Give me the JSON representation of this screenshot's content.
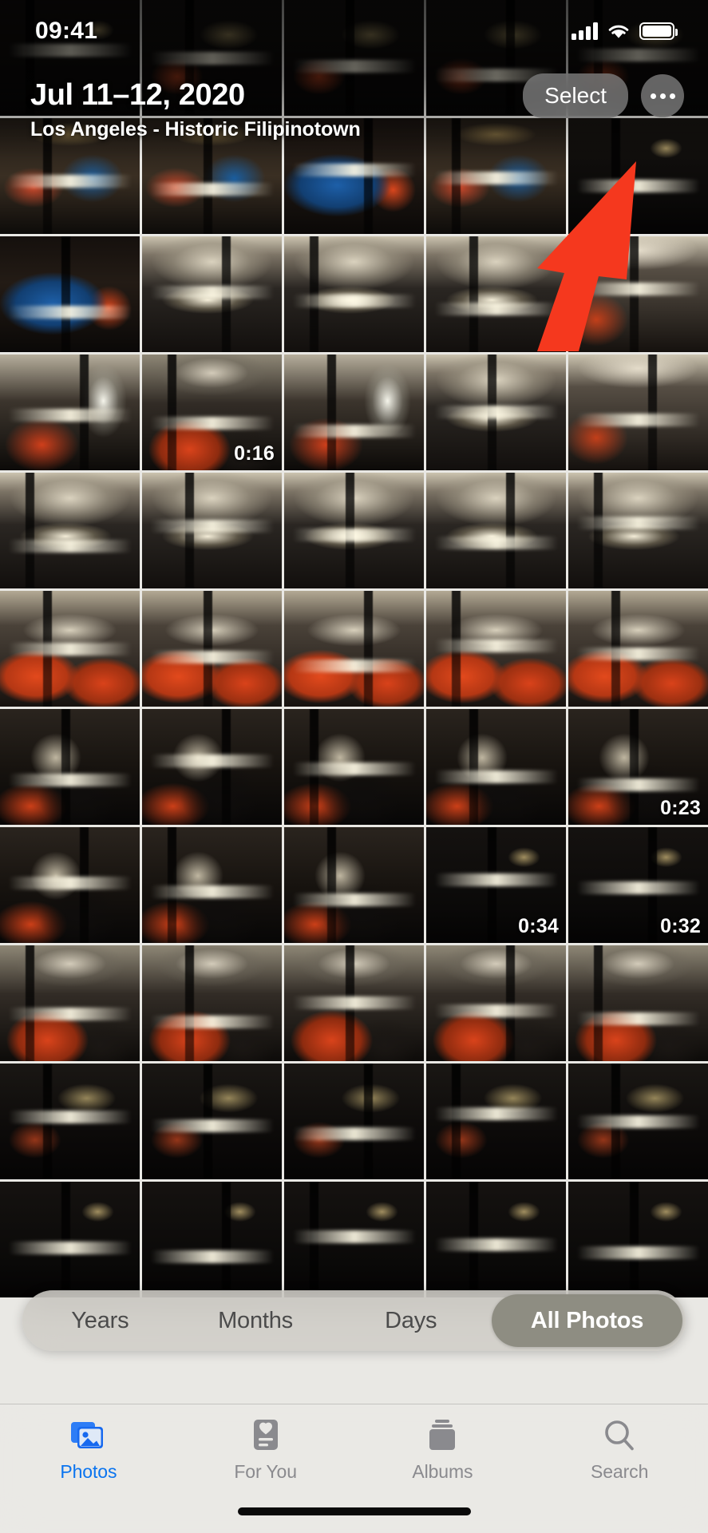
{
  "status_bar": {
    "time": "09:41",
    "cellular_icon": "signal-bars-icon",
    "wifi_icon": "wifi-icon",
    "battery_icon": "battery-full-icon"
  },
  "nav": {
    "title": "Jul 11–12, 2020",
    "subtitle": "Los Angeles - Historic Filipinotown",
    "select_label": "Select",
    "more_icon": "ellipsis-icon"
  },
  "annotation": {
    "type": "arrow",
    "color": "#F5381E",
    "points_to": "more-button"
  },
  "segmented_control": {
    "options": [
      "Years",
      "Months",
      "Days",
      "All Photos"
    ],
    "selected": "All Photos"
  },
  "tab_bar": {
    "items": [
      {
        "label": "Photos",
        "icon": "photos-icon",
        "active": true
      },
      {
        "label": "For You",
        "icon": "for-you-icon",
        "active": false
      },
      {
        "label": "Albums",
        "icon": "albums-icon",
        "active": false
      },
      {
        "label": "Search",
        "icon": "search-icon",
        "active": false
      }
    ],
    "active_color": "#0A74EF",
    "inactive_color": "#8A8A8E"
  },
  "grid": {
    "columns": 5,
    "tiles": [
      {
        "style": "v-night"
      },
      {
        "style": "v-dark"
      },
      {
        "style": "v-dark"
      },
      {
        "style": "v-dark"
      },
      {
        "style": "v-dark"
      },
      {
        "style": "v-street"
      },
      {
        "style": "v-street"
      },
      {
        "style": "v-blue"
      },
      {
        "style": "v-street"
      },
      {
        "style": "v-night"
      },
      {
        "style": "v-blue"
      },
      {
        "style": "v-interior"
      },
      {
        "style": "v-interior"
      },
      {
        "style": "v-interior"
      },
      {
        "style": "v-toppost"
      },
      {
        "style": "v-window"
      },
      {
        "style": "v-seatback",
        "duration": "0:16"
      },
      {
        "style": "v-window"
      },
      {
        "style": "v-interior"
      },
      {
        "style": "v-toppost"
      },
      {
        "style": "v-interior"
      },
      {
        "style": "v-interior"
      },
      {
        "style": "v-interior"
      },
      {
        "style": "v-interior"
      },
      {
        "style": "v-interior"
      },
      {
        "style": "v-vest"
      },
      {
        "style": "v-vest"
      },
      {
        "style": "v-vest"
      },
      {
        "style": "v-vest"
      },
      {
        "style": "v-vest"
      },
      {
        "style": "v-hair"
      },
      {
        "style": "v-hair"
      },
      {
        "style": "v-hair"
      },
      {
        "style": "v-hair"
      },
      {
        "style": "v-hair",
        "duration": "0:23"
      },
      {
        "style": "v-hair"
      },
      {
        "style": "v-hair"
      },
      {
        "style": "v-hair"
      },
      {
        "style": "v-night",
        "duration": "0:34"
      },
      {
        "style": "v-night",
        "duration": "0:32"
      },
      {
        "style": "v-seatback"
      },
      {
        "style": "v-seatback"
      },
      {
        "style": "v-seatback"
      },
      {
        "style": "v-seatback"
      },
      {
        "style": "v-seatback"
      },
      {
        "style": "v-dark"
      },
      {
        "style": "v-dark"
      },
      {
        "style": "v-dark"
      },
      {
        "style": "v-dark"
      },
      {
        "style": "v-dark"
      },
      {
        "style": "v-night"
      },
      {
        "style": "v-night"
      },
      {
        "style": "v-night"
      },
      {
        "style": "v-night"
      },
      {
        "style": "v-night"
      }
    ]
  }
}
